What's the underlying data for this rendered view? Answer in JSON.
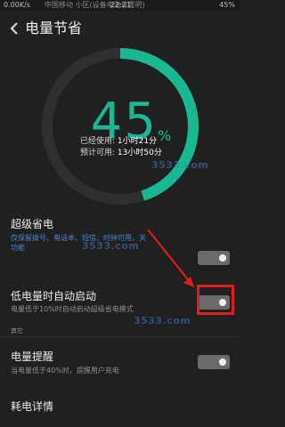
{
  "status_bar": {
    "speed": "0.00K/s",
    "carrier": "中国移动  小区(设备电池设置明)",
    "time": "22:21",
    "battery": "45%"
  },
  "header": {
    "title": "电量节省"
  },
  "gauge": {
    "percent": "45",
    "percent_sign": "%",
    "level": 0.45,
    "used_label": "已经使用:",
    "used_value": "1小时21分",
    "remaining_label": "预计可用:",
    "remaining_value": "13小时50分",
    "accent_color": "#19b892"
  },
  "settings": {
    "super_saving": {
      "title": "超级省电",
      "subtitle_1": "仅保留拨号、电话本、短信、时钟可用，关",
      "subtitle_2": "功能",
      "toggle_on": false
    },
    "auto_start": {
      "title": "低电量时自动启动",
      "subtitle": "电量低于10%时自动启动超级省电模式",
      "toggle_on": false
    },
    "section_other": "其它",
    "low_battery_alert": {
      "title": "电量提醒",
      "subtitle": "当电量低于40%时，提醒用户充电",
      "toggle_on": false
    },
    "power_details": {
      "title": "耗电详情"
    }
  },
  "watermark": "3533.com"
}
